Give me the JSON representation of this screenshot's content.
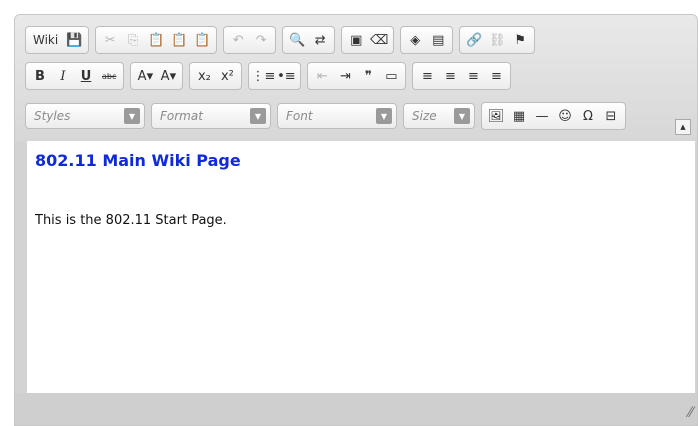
{
  "toolbar": {
    "row1": [
      {
        "name": "wiki-button",
        "label": "Wiki",
        "icon": "document-icon"
      },
      {
        "name": "save-button",
        "label": "💾",
        "icon": "save-icon"
      },
      {
        "name": "cut-button",
        "label": "✂",
        "icon": "cut-icon",
        "dim": true
      },
      {
        "name": "copy-button",
        "label": "⎘",
        "icon": "copy-icon",
        "dim": true
      },
      {
        "name": "paste-button",
        "label": "📋",
        "icon": "paste-icon"
      },
      {
        "name": "paste-text-button",
        "label": "📋",
        "icon": "paste-text-icon"
      },
      {
        "name": "paste-word-button",
        "label": "📋",
        "icon": "paste-word-icon"
      },
      {
        "name": "undo-button",
        "label": "↶",
        "icon": "undo-icon",
        "dim": true
      },
      {
        "name": "redo-button",
        "label": "↷",
        "icon": "redo-icon",
        "dim": true
      },
      {
        "name": "find-button",
        "label": "🔍",
        "icon": "find-icon"
      },
      {
        "name": "replace-button",
        "label": "⇄",
        "icon": "replace-icon"
      },
      {
        "name": "select-all-button",
        "label": "▣",
        "icon": "select-all-icon"
      },
      {
        "name": "remove-format-button",
        "label": "⌫",
        "icon": "eraser-icon"
      },
      {
        "name": "maximize-button",
        "label": "◈",
        "icon": "maximize-icon"
      },
      {
        "name": "show-blocks-button",
        "label": "▤",
        "icon": "show-blocks-icon"
      },
      {
        "name": "link-button",
        "label": "🔗",
        "icon": "link-icon"
      },
      {
        "name": "unlink-button",
        "label": "⛓",
        "icon": "unlink-icon",
        "dim": true
      },
      {
        "name": "anchor-button",
        "label": "⚑",
        "icon": "anchor-flag-icon"
      }
    ],
    "row2": [
      {
        "name": "bold-button",
        "label": "B",
        "icon": "bold-icon",
        "cls": "bold"
      },
      {
        "name": "italic-button",
        "label": "I",
        "icon": "italic-icon",
        "cls": "ital"
      },
      {
        "name": "underline-button",
        "label": "U",
        "icon": "underline-icon",
        "cls": "und"
      },
      {
        "name": "strike-button",
        "label": "abc",
        "icon": "strikethrough-icon",
        "cls": "strike"
      },
      {
        "name": "text-color-button",
        "label": "A▾",
        "icon": "text-color-icon"
      },
      {
        "name": "bg-color-button",
        "label": "A▾",
        "icon": "background-color-icon"
      },
      {
        "name": "subscript-button",
        "label": "x₂",
        "icon": "subscript-icon"
      },
      {
        "name": "superscript-button",
        "label": "x²",
        "icon": "superscript-icon"
      },
      {
        "name": "numbered-list-button",
        "label": "⋮≡",
        "icon": "numbered-list-icon"
      },
      {
        "name": "bulleted-list-button",
        "label": "•≡",
        "icon": "bulleted-list-icon"
      },
      {
        "name": "outdent-button",
        "label": "⇤",
        "icon": "outdent-icon",
        "dim": true
      },
      {
        "name": "indent-button",
        "label": "⇥",
        "icon": "indent-icon"
      },
      {
        "name": "blockquote-button",
        "label": "❞",
        "icon": "blockquote-icon"
      },
      {
        "name": "div-button",
        "label": "▭",
        "icon": "div-container-icon"
      },
      {
        "name": "align-left-button",
        "label": "≡",
        "icon": "align-left-icon"
      },
      {
        "name": "align-center-button",
        "label": "≡",
        "icon": "align-center-icon"
      },
      {
        "name": "align-right-button",
        "label": "≡",
        "icon": "align-right-icon"
      },
      {
        "name": "align-justify-button",
        "label": "≡",
        "icon": "align-justify-icon"
      }
    ],
    "row3_combos": [
      {
        "name": "styles-combo",
        "label": "Styles"
      },
      {
        "name": "format-combo",
        "label": "Format"
      },
      {
        "name": "font-combo",
        "label": "Font"
      },
      {
        "name": "size-combo",
        "label": "Size"
      }
    ],
    "row3_buttons": [
      {
        "name": "image-button",
        "label": "🖼",
        "icon": "image-icon"
      },
      {
        "name": "table-button",
        "label": "▦",
        "icon": "table-icon"
      },
      {
        "name": "horizontal-rule-button",
        "label": "—",
        "icon": "horizontal-rule-icon"
      },
      {
        "name": "smiley-button",
        "label": "☺",
        "icon": "smiley-icon"
      },
      {
        "name": "special-char-button",
        "label": "Ω",
        "icon": "omega-icon"
      },
      {
        "name": "page-break-button",
        "label": "⊟",
        "icon": "page-break-icon"
      }
    ],
    "collapse_label": "▲"
  },
  "content": {
    "heading": "802.11 Main Wiki Page",
    "paragraph": "This is the 802.11 Start Page."
  },
  "statusbar": {
    "resize_label": "⁄⁄"
  },
  "colors": {
    "heading": "#0f2ad6",
    "toolbar_bg": "#e0e0e0"
  }
}
